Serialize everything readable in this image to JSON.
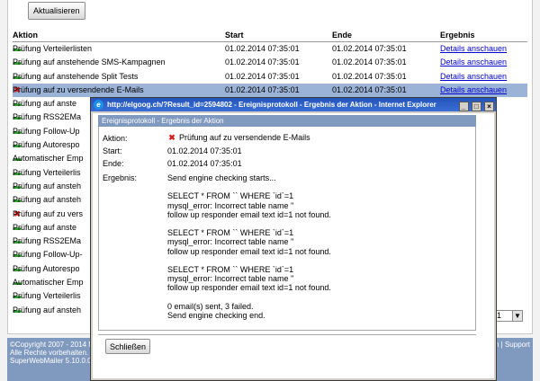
{
  "toolbar": {
    "refresh_label": "Aktualisieren"
  },
  "table": {
    "headers": [
      "Aktion",
      "Start",
      "Ende",
      "Ergebnis"
    ],
    "rows": [
      {
        "status": "ok",
        "action": "Prüfung Verteilerlisten",
        "start": "01.02.2014 07:35:01",
        "end": "01.02.2014 07:35:01",
        "result": "Details anschauen"
      },
      {
        "status": "ok",
        "action": "Prüfung auf anstehende SMS-Kampagnen",
        "start": "01.02.2014 07:35:01",
        "end": "01.02.2014 07:35:01",
        "result": "Details anschauen"
      },
      {
        "status": "ok",
        "action": "Prüfung auf anstehende Split Tests",
        "start": "01.02.2014 07:35:01",
        "end": "01.02.2014 07:35:01",
        "result": "Details anschauen"
      },
      {
        "status": "error",
        "action": "Prüfung auf zu versendende E-Mails",
        "start": "01.02.2014 07:35:01",
        "end": "01.02.2014 07:35:01",
        "result": "Details anschauen"
      },
      {
        "status": "ok",
        "action": "Prüfung auf anste",
        "start": "",
        "end": "",
        "result": "n"
      },
      {
        "status": "ok",
        "action": "Prüfung RSS2EMa",
        "start": "",
        "end": "",
        "result": "n"
      },
      {
        "status": "ok",
        "action": "Prüfung Follow-Up",
        "start": "",
        "end": "",
        "result": "n"
      },
      {
        "status": "ok",
        "action": "Prüfung Autorespo",
        "start": "",
        "end": "",
        "result": "n"
      },
      {
        "status": "ok",
        "action": "Automatischer Emp",
        "start": "",
        "end": "",
        "result": "n"
      },
      {
        "status": "ok",
        "action": "Prüfung Verteilerlis",
        "start": "",
        "end": "",
        "result": "n"
      },
      {
        "status": "ok",
        "action": "Prüfung auf ansteh",
        "start": "",
        "end": "",
        "result": "n"
      },
      {
        "status": "ok",
        "action": "Prüfung auf ansteh",
        "start": "",
        "end": "",
        "result": "n"
      },
      {
        "status": "error",
        "action": "Prüfung auf zu vers",
        "start": "",
        "end": "",
        "result": "n"
      },
      {
        "status": "ok",
        "action": "Prüfung auf anste",
        "start": "",
        "end": "",
        "result": "n"
      },
      {
        "status": "ok",
        "action": "Prüfung RSS2EMa",
        "start": "",
        "end": "",
        "result": "n"
      },
      {
        "status": "ok",
        "action": "Prüfung Follow-Up-",
        "start": "",
        "end": "",
        "result": "n"
      },
      {
        "status": "ok",
        "action": "Prüfung Autorespo",
        "start": "",
        "end": "",
        "result": "n"
      },
      {
        "status": "ok",
        "action": "Automatischer Emp",
        "start": "",
        "end": "",
        "result": "n"
      },
      {
        "status": "ok",
        "action": "Prüfung Verteilerlis",
        "start": "",
        "end": "",
        "result": ""
      },
      {
        "status": "ok",
        "action": "Prüfung auf ansteh",
        "start": "",
        "end": "",
        "result": ""
      }
    ],
    "selected_index": 3
  },
  "pager": {
    "value": "1"
  },
  "footer": {
    "line1": "©Copyright 2007 - 2014 M",
    "line2": "Alle Rechte vorbehalten.",
    "line3": "SuperWebMailer 5.10.0.0",
    "right_text": "n | Support"
  },
  "popup": {
    "title": "http://elgoog.ch/?Result_id=2594802 - Ereignisprotokoll - Ergebnis der Aktion - Internet Explorer",
    "header": "Ereignisprotokoll - Ergebnis der Aktion",
    "fields": {
      "action_label": "Aktion:",
      "action_value": "Prüfung auf zu versendende E-Mails",
      "start_label": "Start:",
      "start_value": "01.02.2014 07:35:01",
      "end_label": "Ende:",
      "end_value": "01.02.2014 07:35:01",
      "result_label": "Ergebnis:"
    },
    "log": "Send engine checking starts...\n\nSELECT * FROM `` WHERE `id`=1\nmysql_error: Incorrect table name ''\nfollow up responder email text id=1 not found.\n\nSELECT * FROM `` WHERE `id`=1\nmysql_error: Incorrect table name ''\nfollow up responder email text id=1 not found.\n\nSELECT * FROM `` WHERE `id`=1\nmysql_error: Incorrect table name ''\nfollow up responder email text id=1 not found.\n\n0 email(s) sent, 3 failed.\nSend engine checking end.",
    "close_label": "Schließen",
    "window_buttons": {
      "minimize": "_",
      "maximize": "□",
      "close": "×"
    }
  },
  "colors": {
    "accent": "#8099bf",
    "selected_row": "#9bb3d6",
    "ok": "#2f9a2f",
    "error": "#d62020",
    "link": "#0000cc"
  },
  "icons": {
    "ok": "dash-ok-icon",
    "error": "red-x-icon"
  }
}
